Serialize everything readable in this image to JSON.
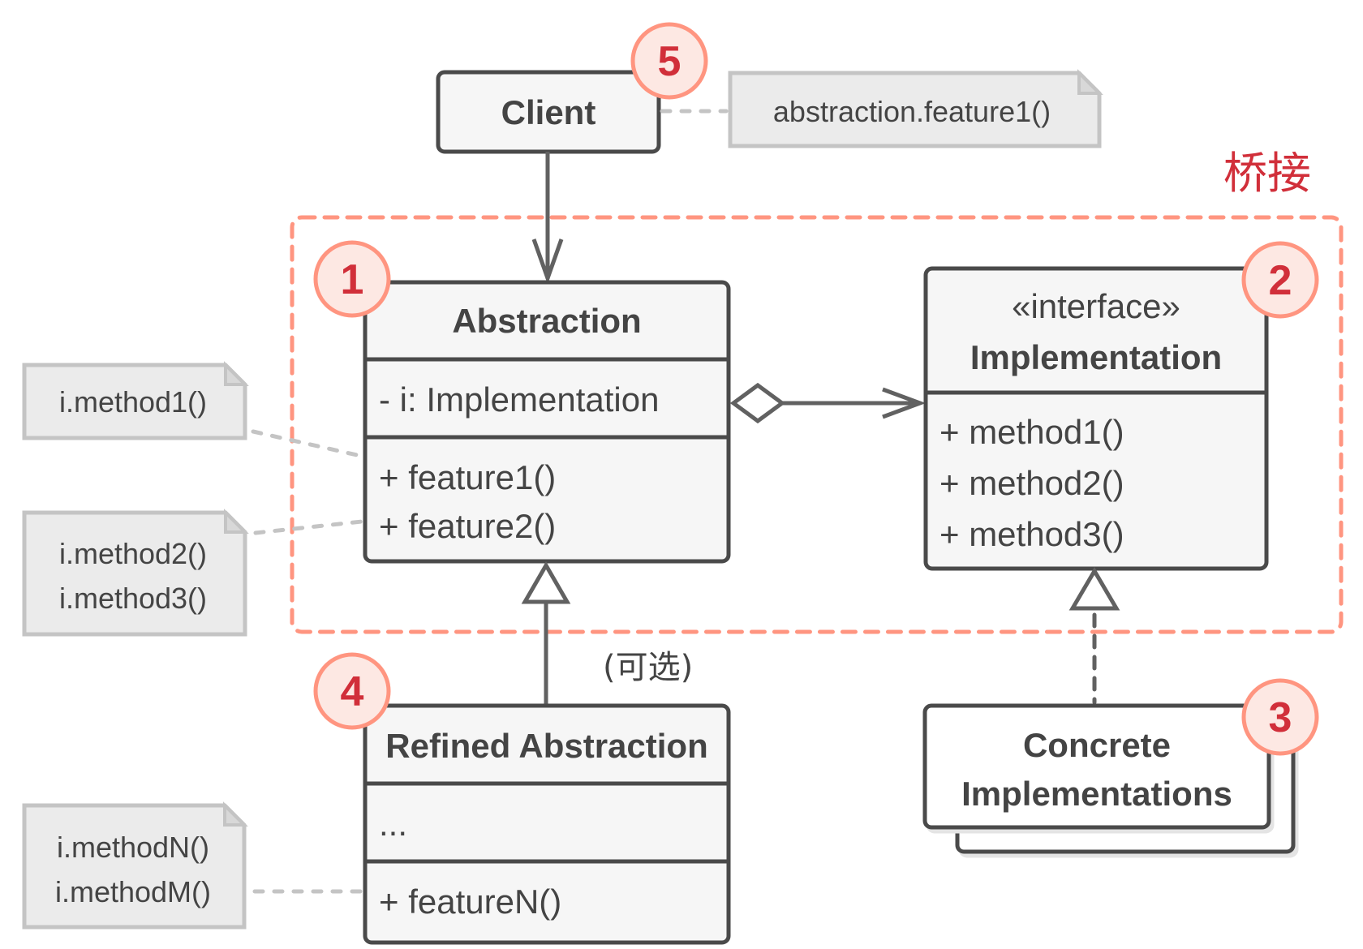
{
  "diagram": {
    "title": "桥接",
    "colors": {
      "frame": "#ff9580",
      "badge_text": "#d12f3a",
      "badge_fill": "#fde8e3",
      "box_stroke": "#4a4a4a",
      "box_fill": "#f6f6f6",
      "note_fill": "#ebebeb",
      "note_stroke": "#c4c4c4",
      "text": "#444444"
    },
    "client": {
      "name": "Client",
      "badge": "5",
      "note": "abstraction.feature1()"
    },
    "abstraction": {
      "name": "Abstraction",
      "badge": "1",
      "fields": [
        "- i: Implementation"
      ],
      "methods": [
        "+ feature1()",
        "+ feature2()"
      ],
      "notes": [
        {
          "lines": [
            "i.method1()"
          ]
        },
        {
          "lines": [
            "i.method2()",
            "i.method3()"
          ]
        }
      ]
    },
    "implementation": {
      "stereotype": "«interface»",
      "name": "Implementation",
      "badge": "2",
      "methods": [
        "+ method1()",
        "+ method2()",
        "+ method3()"
      ]
    },
    "concrete": {
      "name_lines": [
        "Concrete",
        "Implementations"
      ],
      "badge": "3"
    },
    "refined": {
      "name": "Refined Abstraction",
      "badge": "4",
      "fields": [
        "..."
      ],
      "methods": [
        "+ featureN()"
      ],
      "note": {
        "lines": [
          "i.methodN()",
          "i.methodM()"
        ]
      },
      "optional_label": "(可选)"
    },
    "relations": [
      {
        "from": "Client",
        "to": "Abstraction",
        "type": "association"
      },
      {
        "from": "Abstraction",
        "to": "Implementation",
        "type": "aggregation"
      },
      {
        "from": "Refined Abstraction",
        "to": "Abstraction",
        "type": "inheritance"
      },
      {
        "from": "Concrete Implementations",
        "to": "Implementation",
        "type": "realization"
      }
    ]
  }
}
